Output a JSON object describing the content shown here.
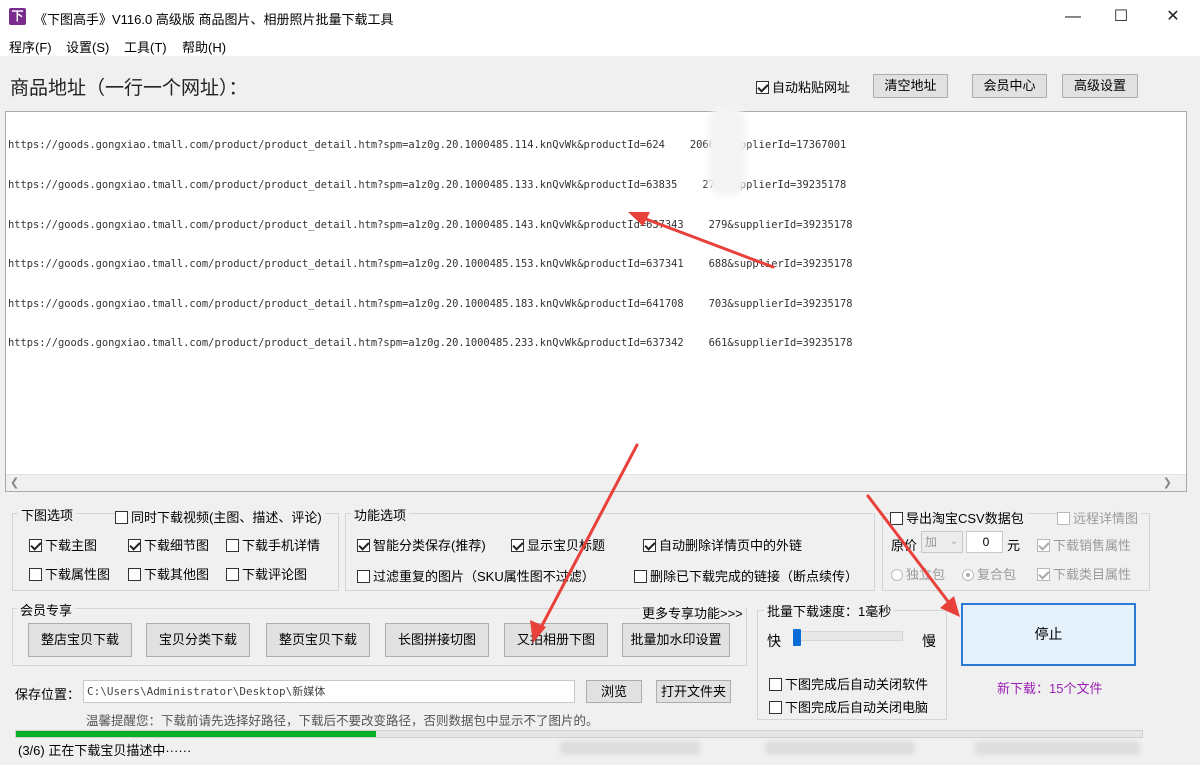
{
  "window": {
    "title": "《下图高手》V116.0 高级版  商品图片、相册照片批量下载工具",
    "icon_glyph": "下",
    "minimize_glyph": "—",
    "maximize_glyph": "☐",
    "close_glyph": "✕"
  },
  "menu": [
    {
      "label": "程序(F)"
    },
    {
      "label": "设置(S)"
    },
    {
      "label": "工具(T)"
    },
    {
      "label": "帮助(H)"
    }
  ],
  "header": {
    "label": "商品地址（一行一个网址）：",
    "auto_paste_label": "自动粘贴网址",
    "auto_paste_checked": true,
    "clear_button": "清空地址",
    "member_button": "会员中心",
    "advanced_button": "高级设置"
  },
  "urls": [
    "https://goods.gongxiao.tmall.com/product/product_detail.htm?spm=a1z0g.20.1000485.114.knQvWk&productId=624    20661&supplierId=17367001",
    "https://goods.gongxiao.tmall.com/product/product_detail.htm?spm=a1z0g.20.1000485.133.knQvWk&productId=63835    279&supplierId=39235178",
    "https://goods.gongxiao.tmall.com/product/product_detail.htm?spm=a1z0g.20.1000485.143.knQvWk&productId=637343    279&supplierId=39235178",
    "https://goods.gongxiao.tmall.com/product/product_detail.htm?spm=a1z0g.20.1000485.153.knQvWk&productId=637341    688&supplierId=39235178",
    "https://goods.gongxiao.tmall.com/product/product_detail.htm?spm=a1z0g.20.1000485.183.knQvWk&productId=641708    703&supplierId=39235178",
    "https://goods.gongxiao.tmall.com/product/product_detail.htm?spm=a1z0g.20.1000485.233.knQvWk&productId=637342    661&supplierId=39235178"
  ],
  "download_options": {
    "title": "下图选项",
    "video_label": "同时下载视频(主图、描述、评论)",
    "video_checked": false,
    "items": [
      {
        "label": "下载主图",
        "checked": true
      },
      {
        "label": "下载细节图",
        "checked": true
      },
      {
        "label": "下载手机详情",
        "checked": false
      },
      {
        "label": "下载属性图",
        "checked": false
      },
      {
        "label": "下载其他图",
        "checked": false
      },
      {
        "label": "下载评论图",
        "checked": false
      }
    ]
  },
  "function_options": {
    "title": "功能选项",
    "items": [
      {
        "label": "智能分类保存(推荐)",
        "checked": true
      },
      {
        "label": "显示宝贝标题",
        "checked": true
      },
      {
        "label": "自动删除详情页中的外链",
        "checked": true
      },
      {
        "label": "过滤重复的图片（SKU属性图不过滤）",
        "checked": false
      },
      {
        "label": "删除已下载完成的链接（断点续传）",
        "checked": false
      }
    ]
  },
  "export": {
    "csv_label": "导出淘宝CSV数据包",
    "csv_checked": false,
    "remote_label": "远程详情图",
    "price_label": "原价",
    "price_op": "加",
    "price_value": "0",
    "price_unit": "元",
    "sales_attr_label": "下载销售属性",
    "category_attr_label": "下载类目属性",
    "single_pack_label": "独立包",
    "combined_pack_label": "复合包"
  },
  "member": {
    "title": "会员专享",
    "more_link": "更多专享功能>>>",
    "buttons": [
      "整店宝贝下载",
      "宝贝分类下载",
      "整页宝贝下载",
      "长图拼接切图",
      "又拍相册下图",
      "批量加水印设置"
    ]
  },
  "speed": {
    "title": "批量下载速度：1毫秒",
    "fast_label": "快",
    "slow_label": "慢",
    "close_software_label": "下图完成后自动关闭软件",
    "shutdown_label": "下图完成后自动关闭电脑"
  },
  "stop_button": "停止",
  "new_downloads": "新下载：15个文件",
  "save": {
    "label": "保存位置：",
    "path": "C:\\Users\\Administrator\\Desktop\\新媒体",
    "browse_button": "浏览",
    "open_folder_button": "打开文件夹",
    "hint": "温馨提醒您：下载前请先选择好路径，下载后不要改变路径，否则数据包中显示不了图片的。"
  },
  "progress": {
    "fraction": 0.32
  },
  "status_text": "(3/6) 正在下载宝贝描述中······",
  "colors": {
    "accent": "#0a6cd6",
    "progress": "#06b025",
    "new_downloads_text": "#9b1fb5",
    "annotation_arrow": "#e8403a"
  }
}
